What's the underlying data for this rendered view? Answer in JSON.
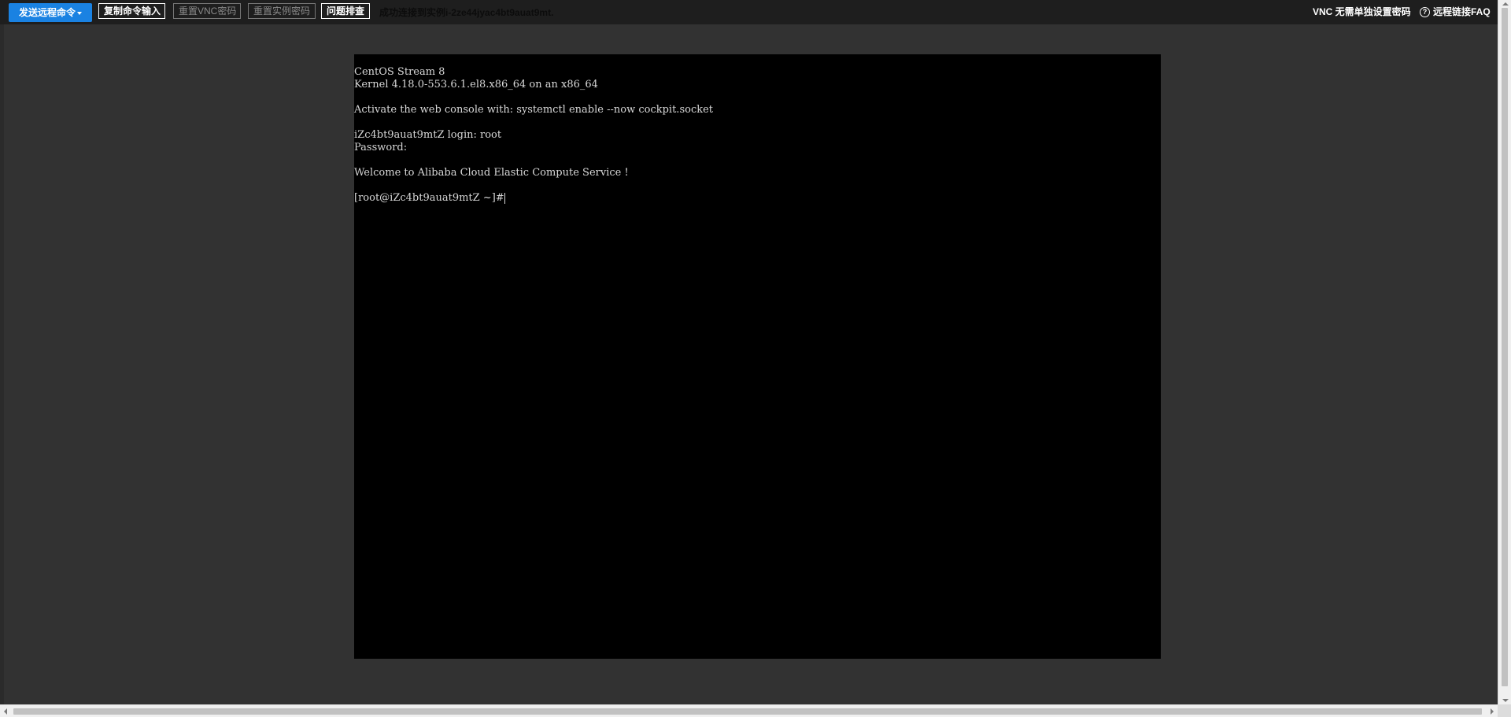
{
  "toolbar": {
    "send_remote_command": "发送远程命令",
    "copy_command_input": "复制命令输入",
    "reset_vnc_password": "重置VNC密码",
    "reset_instance_password": "重置实例密码",
    "troubleshoot": "问题排查",
    "status_message": "成功连接到实例i-2ze44jyac4bt9auat9mt.",
    "vnc_no_password": "VNC 无需单独设置密码",
    "remote_connect_faq": "远程链接FAQ",
    "help_icon_glyph": "?"
  },
  "terminal": {
    "lines": [
      "CentOS Stream 8",
      "Kernel 4.18.0-553.6.1.el8.x86_64 on an x86_64",
      "",
      "Activate the web console with: systemctl enable --now cockpit.socket",
      "",
      "iZc4bt9auat9mtZ login: root",
      "Password:",
      "",
      "Welcome to Alibaba Cloud Elastic Compute Service !",
      "",
      "[root@iZc4bt9auat9mtZ ~]#"
    ]
  },
  "colors": {
    "primary_button": "#1a82e2",
    "toolbar_bg": "#1e1e1e",
    "page_bg": "#323232",
    "terminal_bg": "#000000",
    "terminal_text": "#d8d8d8"
  },
  "icons": {
    "send_dropdown": "caret-down-icon",
    "faq_help": "question-circle-icon"
  }
}
